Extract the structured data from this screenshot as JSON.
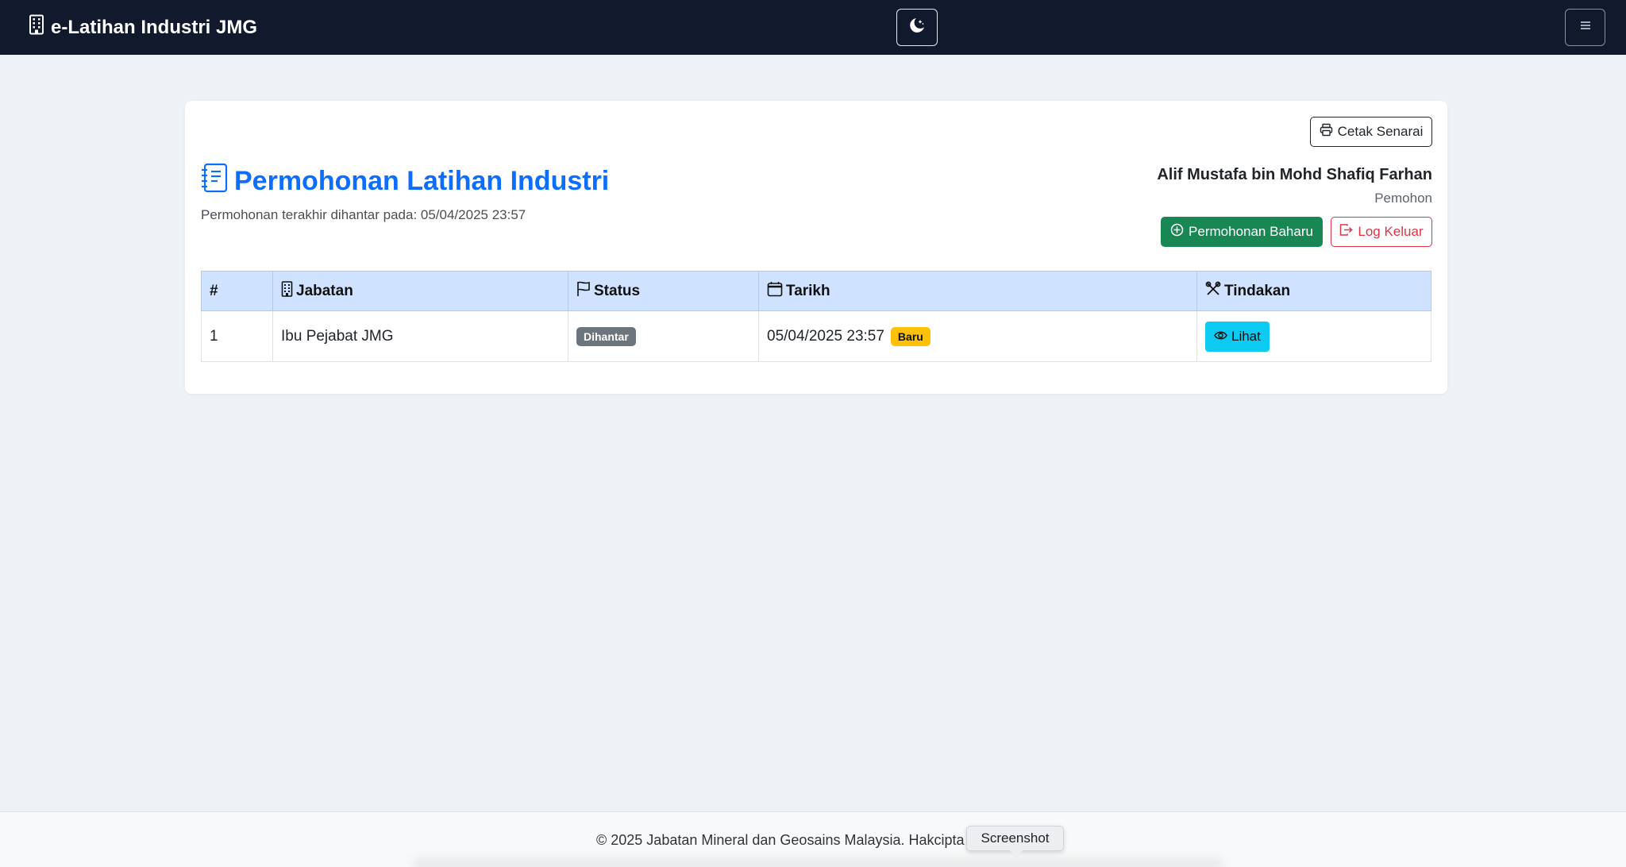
{
  "navbar": {
    "brand": "e-Latihan Industri JMG",
    "icons": {
      "brand": "building-icon",
      "theme": "moon-stars-icon",
      "menu": "hamburger-icon"
    }
  },
  "card": {
    "print_label": "Cetak Senarai",
    "title": "Permohonan Latihan Industri",
    "subtitle": "Permohonan terakhir dihantar pada: 05/04/2025 23:57",
    "user": {
      "name": "Alif Mustafa bin Mohd Shafiq Farhan",
      "role": "Pemohon"
    },
    "actions": {
      "new_label": "Permohonan Baharu",
      "logout_label": "Log Keluar"
    }
  },
  "table": {
    "headers": {
      "no": "#",
      "department": "Jabatan",
      "status": "Status",
      "date": "Tarikh",
      "action": "Tindakan"
    },
    "rows": [
      {
        "no": "1",
        "department": "Ibu Pejabat JMG",
        "status": "Dihantar",
        "date": "05/04/2025 23:57",
        "date_badge": "Baru",
        "action_label": "Lihat"
      }
    ]
  },
  "footer": {
    "text": "© 2025 Jabatan Mineral dan Geosains Malaysia. Hakcipta T",
    "tooltip": "Screenshot"
  },
  "colors": {
    "navbar": "#111a2c",
    "primary": "#0d6efd",
    "success": "#198754",
    "danger": "#dc3545",
    "info": "#0dcaf0",
    "warning": "#ffc107",
    "secondary": "#6c757d",
    "table_header": "#cfe2ff"
  }
}
